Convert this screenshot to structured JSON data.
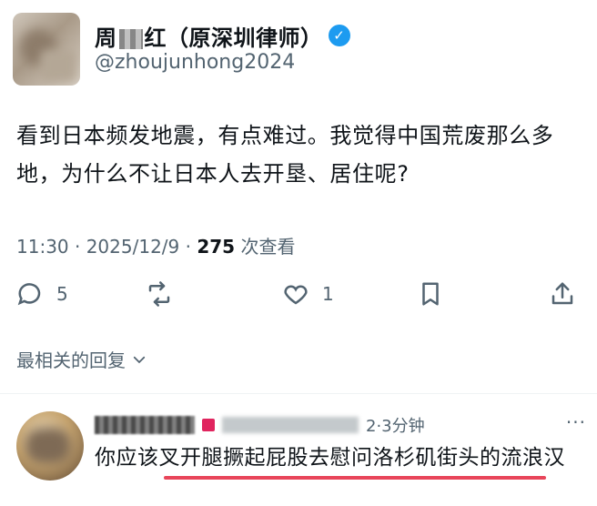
{
  "author": {
    "display_name_prefix": "周",
    "display_name_suffix": "红（原深圳律师）",
    "handle": "@zhoujunhong2024",
    "verified_icon": "verified-check-icon"
  },
  "tweet": {
    "text": "看到日本频发地震，有点难过。我觉得中国荒废那么多地，为什么不让日本人去开垦、居住呢?",
    "time": "11:30 · 2025/12/9 · ",
    "views_count": "275",
    "views_label": " 次查看"
  },
  "actions": {
    "reply_count": "5",
    "retweet_count": "",
    "like_count": "1"
  },
  "sort": {
    "label": "最相关的回复"
  },
  "reply": {
    "timestamp": "2·3分钟",
    "text": "你应该叉开腿撅起屁股去慰问洛杉矶街头的流浪汉"
  },
  "colors": {
    "verified": "#1d9bf0",
    "secondary_text": "#536471",
    "underline": "#e8455a"
  }
}
